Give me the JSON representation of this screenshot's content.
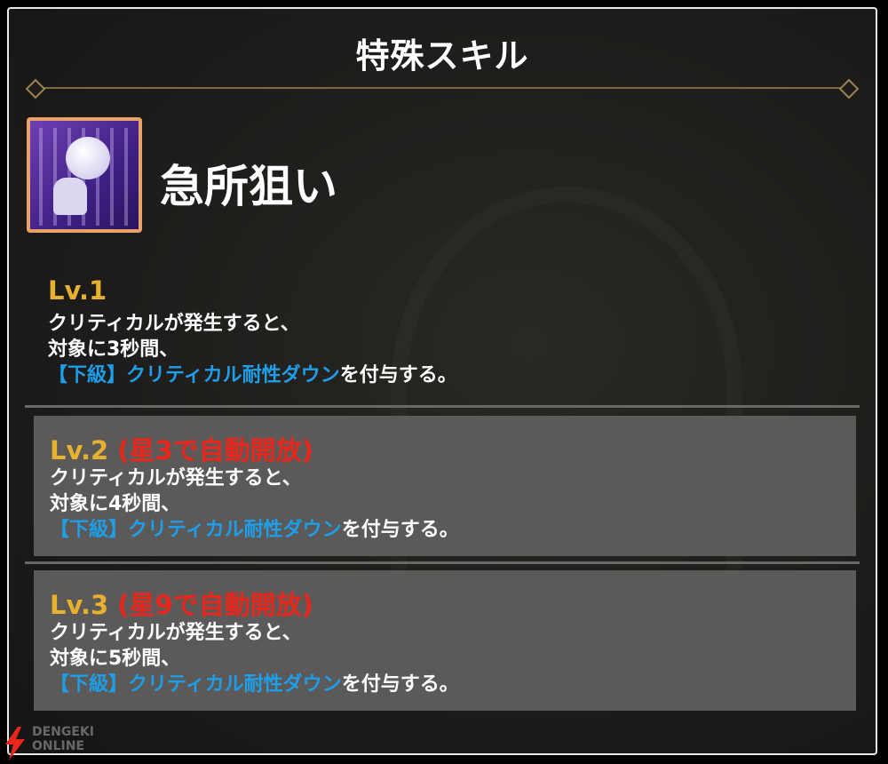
{
  "panel": {
    "title": "特殊スキル",
    "skill_name": "急所狙い"
  },
  "levels": [
    {
      "label": "Lv.1",
      "unlock": "",
      "line1": "クリティカルが発生すると、",
      "line2": "対象に3秒間、",
      "debuff": "【下級】クリティカル耐性ダウン",
      "suffix": "を付与する。"
    },
    {
      "label": "Lv.2",
      "unlock": "(星3で自動開放)",
      "line1": "クリティカルが発生すると、",
      "line2": "対象に4秒間、",
      "debuff": "【下級】クリティカル耐性ダウン",
      "suffix": "を付与する。"
    },
    {
      "label": "Lv.3",
      "unlock": "(星9で自動開放)",
      "line1": "クリティカルが発生すると、",
      "line2": "対象に5秒間、",
      "debuff": "【下級】クリティカル耐性ダウン",
      "suffix": "を付与する。"
    }
  ],
  "watermark": {
    "line1": "DENGEKI",
    "line2": "ONLINE"
  },
  "colors": {
    "level_label": "#e6b130",
    "unlock_text": "#e8261c",
    "debuff_text": "#1e9ee8",
    "locked_bg": "#5c5a58"
  },
  "icons": {
    "skill": "critical-aim-skill-icon",
    "logo": "lightning-bolt-icon"
  }
}
